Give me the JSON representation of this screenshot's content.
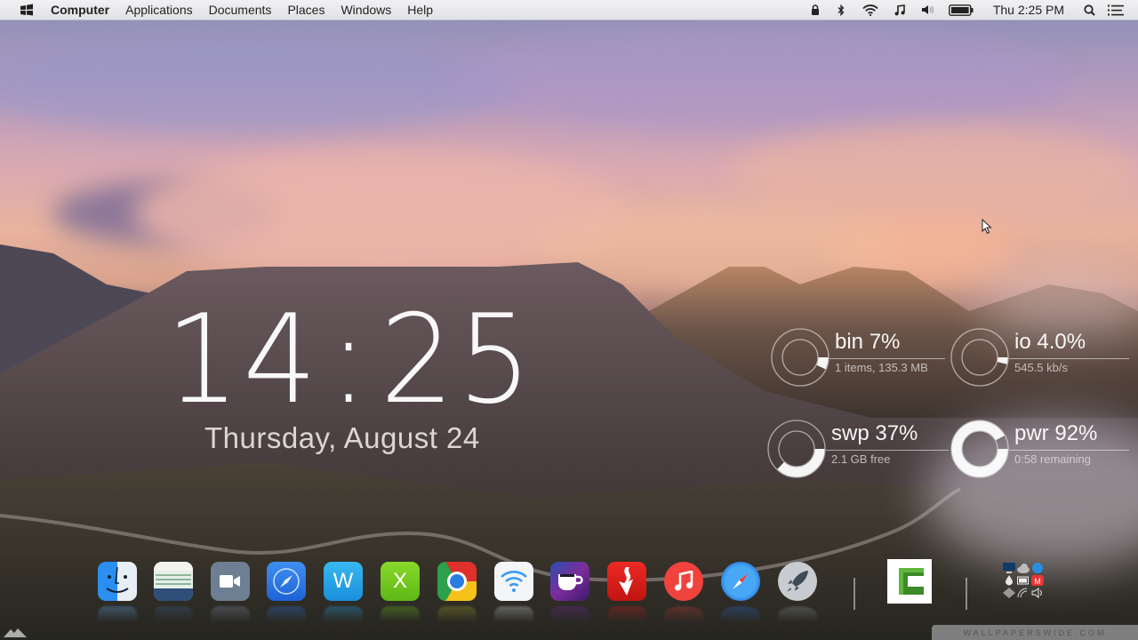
{
  "menubar": {
    "app_menu_icon": "windows-flag-icon",
    "items": [
      "Computer",
      "Applications",
      "Documents",
      "Places",
      "Windows",
      "Help"
    ],
    "tray_icons": [
      "lock-icon",
      "bluetooth-icon",
      "wifi-icon",
      "music-note-icon",
      "volume-icon",
      "battery-icon"
    ],
    "clock": "Thu 2:25 PM",
    "search_icon": "search-icon",
    "list_icon": "notification-list-icon"
  },
  "clock_widget": {
    "hours": "14",
    "separator": ":",
    "minutes": "25",
    "date": "Thursday, August 24"
  },
  "rings": [
    {
      "id": "bin",
      "title": "bin 7%",
      "subtitle": "1 items, 135.3 MB",
      "percent": 7
    },
    {
      "id": "io",
      "title": "io 4.0%",
      "subtitle": "545.5 kb/s",
      "percent": 4
    },
    {
      "id": "swp",
      "title": "swp 37%",
      "subtitle": "2.1 GB free",
      "percent": 37
    },
    {
      "id": "pwr",
      "title": "pwr 92%",
      "subtitle": "0:58 remaining",
      "percent": 92
    }
  ],
  "dock": {
    "apps": [
      {
        "name": "Finder",
        "icon": "finder-icon"
      },
      {
        "name": "Notes",
        "icon": "notes-icon"
      },
      {
        "name": "Video Chat",
        "icon": "video-camera-icon"
      },
      {
        "name": "Safari Browser",
        "icon": "compass-icon"
      },
      {
        "name": "Word",
        "icon": "word-icon",
        "label": "W"
      },
      {
        "name": "Excel",
        "icon": "excel-icon",
        "label": "X"
      },
      {
        "name": "Chrome",
        "icon": "chrome-icon"
      },
      {
        "name": "Wi-Fi",
        "icon": "wifi-icon"
      },
      {
        "name": "Caffeine",
        "icon": "coffee-cup-icon"
      },
      {
        "name": "Downloader",
        "icon": "download-arrow-icon"
      },
      {
        "name": "Music",
        "icon": "music-note-icon"
      },
      {
        "name": "Safari",
        "icon": "compass-icon"
      },
      {
        "name": "Launchpad",
        "icon": "rocket-icon"
      },
      {
        "name": "Camtasia",
        "icon": "camtasia-icon",
        "label": "C"
      }
    ],
    "stack_icons": [
      "monitor-icon",
      "cloud-icon",
      "sync-icon",
      "droplet-icon",
      "battery-icon",
      "mega-icon",
      "diamond-icon",
      "wifi-signal-icon",
      "speaker-icon"
    ]
  },
  "watermark": "WALLPAPERSWIDE.COM"
}
